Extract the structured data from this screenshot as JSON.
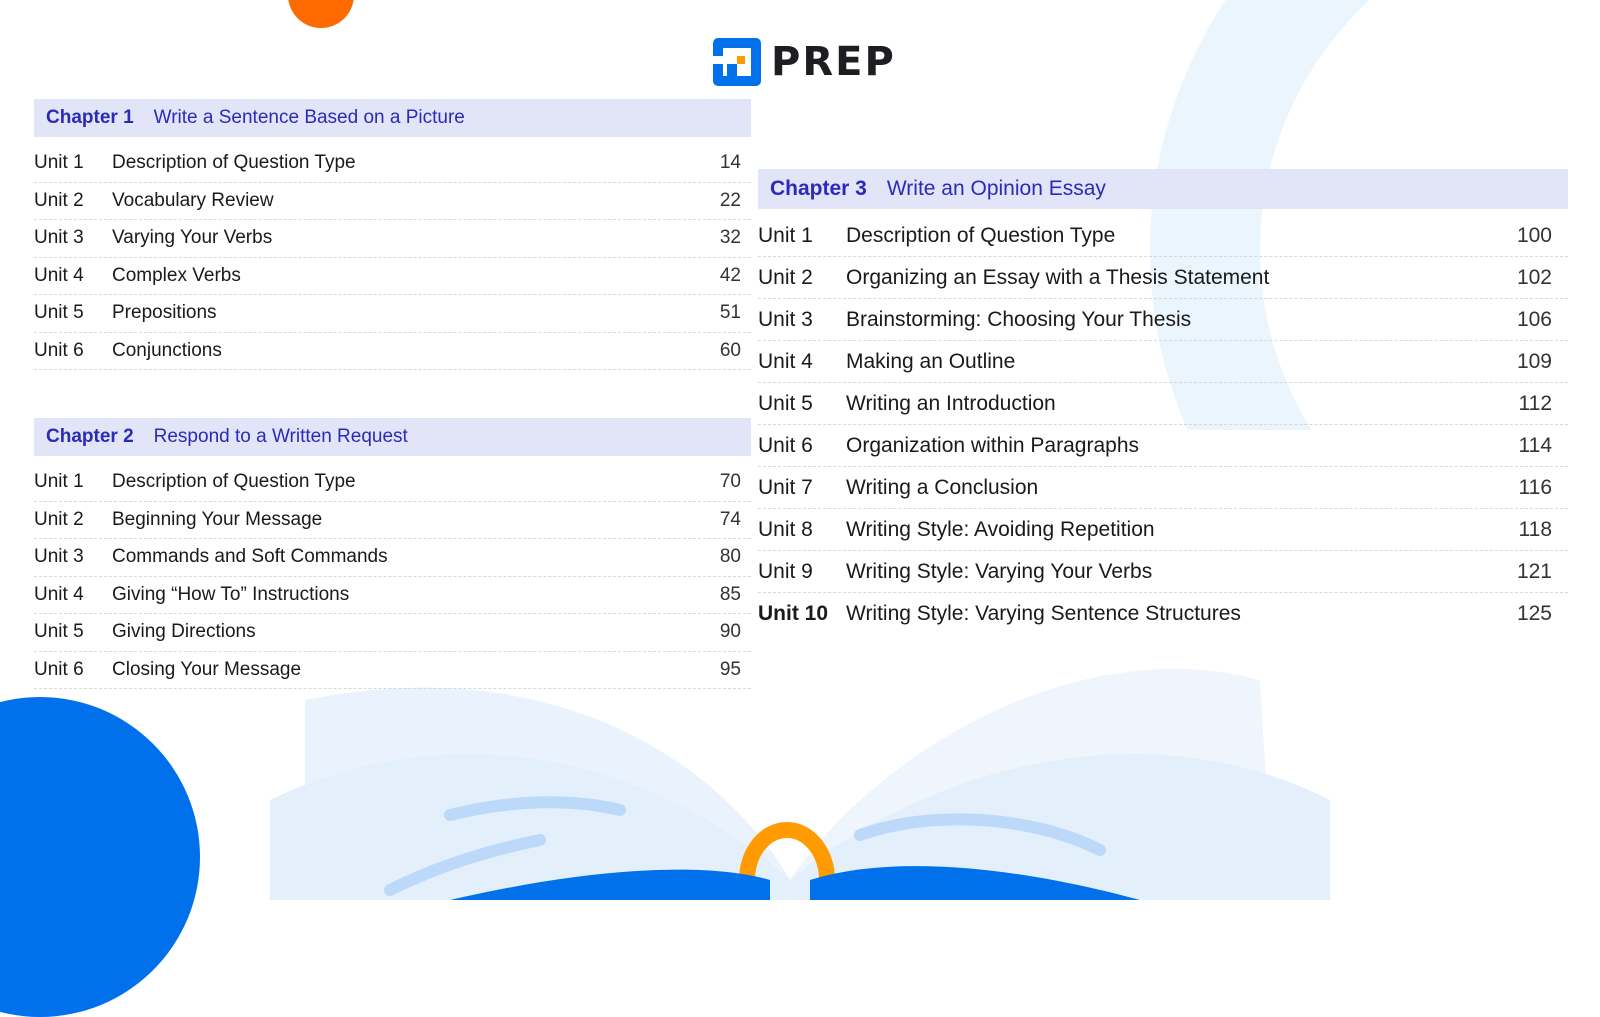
{
  "brand": {
    "name": "PREP",
    "primary_color": "#0071eb",
    "accent_color": "#ff9a00"
  },
  "chapters": [
    {
      "label": "Chapter 1",
      "title": "Write a Sentence Based on a Picture",
      "units": [
        {
          "unit": "Unit 1",
          "title": "Description of Question Type",
          "page": "14"
        },
        {
          "unit": "Unit 2",
          "title": "Vocabulary Review",
          "page": "22"
        },
        {
          "unit": "Unit 3",
          "title": "Varying Your Verbs",
          "page": "32"
        },
        {
          "unit": "Unit 4",
          "title": "Complex Verbs",
          "page": "42"
        },
        {
          "unit": "Unit 5",
          "title": "Prepositions",
          "page": "51"
        },
        {
          "unit": "Unit 6",
          "title": "Conjunctions",
          "page": "60"
        }
      ]
    },
    {
      "label": "Chapter 2",
      "title": "Respond to a Written Request",
      "units": [
        {
          "unit": "Unit 1",
          "title": "Description of Question Type",
          "page": "70"
        },
        {
          "unit": "Unit 2",
          "title": "Beginning Your Message",
          "page": "74"
        },
        {
          "unit": "Unit 3",
          "title": "Commands and Soft Commands",
          "page": "80"
        },
        {
          "unit": "Unit 4",
          "title": "Giving “How To” Instructions",
          "page": "85"
        },
        {
          "unit": "Unit 5",
          "title": "Giving Directions",
          "page": "90"
        },
        {
          "unit": "Unit 6",
          "title": "Closing Your Message",
          "page": "95"
        }
      ]
    },
    {
      "label": "Chapter 3",
      "title": "Write an Opinion Essay",
      "units": [
        {
          "unit": "Unit 1",
          "title": "Description of Question Type",
          "page": "100"
        },
        {
          "unit": "Unit 2",
          "title": "Organizing an Essay with a Thesis Statement",
          "page": "102"
        },
        {
          "unit": "Unit 3",
          "title": "Brainstorming: Choosing Your Thesis",
          "page": "106"
        },
        {
          "unit": "Unit 4",
          "title": "Making an Outline",
          "page": "109"
        },
        {
          "unit": "Unit 5",
          "title": "Writing an Introduction",
          "page": "112"
        },
        {
          "unit": "Unit 6",
          "title": "Organization within Paragraphs",
          "page": "114"
        },
        {
          "unit": "Unit 7",
          "title": "Writing a Conclusion",
          "page": "116"
        },
        {
          "unit": "Unit 8",
          "title": "Writing Style: Avoiding Repetition",
          "page": "118"
        },
        {
          "unit": "Unit 9",
          "title": "Writing Style: Varying Your Verbs",
          "page": "121"
        },
        {
          "unit": "Unit 10",
          "title": "Writing Style: Varying Sentence Structures",
          "page": "125"
        }
      ]
    }
  ]
}
